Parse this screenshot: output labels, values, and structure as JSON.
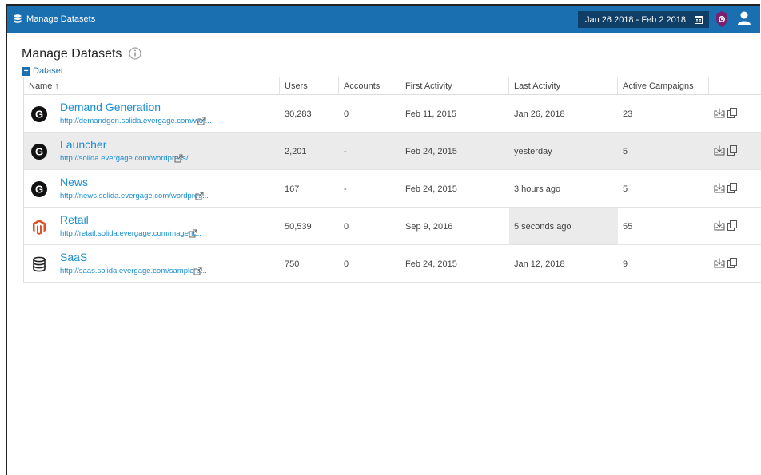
{
  "header": {
    "app_title": "Manage Datasets",
    "date_range": "Jan 26 2018 - Feb 2 2018",
    "accent": "#1a6fb0"
  },
  "page": {
    "title": "Manage Datasets",
    "add_label": "Dataset"
  },
  "table": {
    "columns": [
      "Name ↑",
      "Users",
      "Accounts",
      "First Activity",
      "Last Activity",
      "Active Campaigns"
    ],
    "rows": [
      {
        "name": "Demand Generation",
        "url": "http://demandgen.solida.evergage.com/wor...",
        "users": "30,283",
        "accounts": "0",
        "first": "Feb 11, 2015",
        "last": "Jan 26, 2018",
        "active": "23",
        "icon": "g-logo-icon"
      },
      {
        "name": "Launcher",
        "url": "http://solida.evergage.com/wordpress/",
        "users": "2,201",
        "accounts": "-",
        "first": "Feb 24, 2015",
        "last": "yesterday",
        "active": "5",
        "icon": "g-logo-icon"
      },
      {
        "name": "News",
        "url": "http://news.solida.evergage.com/wordpres...",
        "users": "167",
        "accounts": "-",
        "first": "Feb 24, 2015",
        "last": "3 hours ago",
        "active": "5",
        "icon": "g-logo-icon"
      },
      {
        "name": "Retail",
        "url": "http://retail.solida.evergage.com/magent...",
        "users": "50,539",
        "accounts": "0",
        "first": "Sep 9, 2016",
        "last": "5 seconds ago",
        "active": "55",
        "icon": "magento-logo-icon"
      },
      {
        "name": "SaaS",
        "url": "http://saas.solida.evergage.com/sample-a...",
        "users": "750",
        "accounts": "0",
        "first": "Feb 24, 2015",
        "last": "Jan 12, 2018",
        "active": "9",
        "icon": "database-icon"
      }
    ]
  }
}
